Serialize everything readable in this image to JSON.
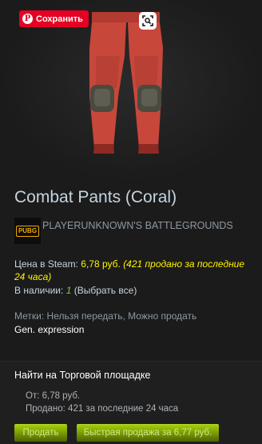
{
  "image_overlay": {
    "pin_button_label": "Сохранить",
    "pin_logo": "P",
    "lens_icon": "lens-icon"
  },
  "item": {
    "title": "Combat Pants (Coral)",
    "game_icon_text": "PUBG",
    "game_name": "PLAYERUNKNOWN'S BATTLEGROUNDS",
    "colors": {
      "pants": "#c8473b",
      "pants_shadow": "#8e2a22",
      "knee_pad": "#4a4a40"
    }
  },
  "price": {
    "label": "Цена в Steam:",
    "value": "6,78 руб.",
    "note": "(421 продано за последние 24 часа)"
  },
  "stock": {
    "label": "В наличии:",
    "count": "1",
    "select_all_open": "(",
    "select_all": "Выбрать все",
    "select_all_close": ")"
  },
  "tags": {
    "text": "Метки: Нельзя передать, Можно продать",
    "expression": "Gen. expression"
  },
  "market": {
    "title": "Найти на Торговой площадке",
    "from": "От: 6,78 руб.",
    "sold": "Продано: 421 за последние 24 часа",
    "sell_button": "Продать",
    "quick_sell_button": "Быстрая продажа за 6,77 руб."
  }
}
